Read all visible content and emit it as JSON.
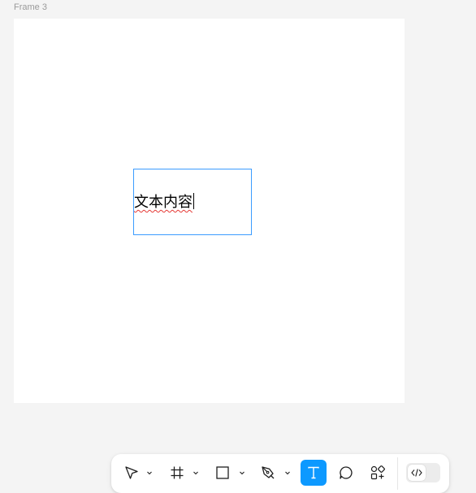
{
  "canvas": {
    "frame_label": "Frame 3",
    "text_layer": {
      "content": "文本内容",
      "selection_color": "#3b9cff",
      "spellcheck_color": "#e53935"
    }
  },
  "toolbar": {
    "tools": [
      {
        "name": "move-tool",
        "icon": "pointer-arrow-icon",
        "has_dropdown": true,
        "active": false
      },
      {
        "name": "frame-tool",
        "icon": "hash-frame-icon",
        "has_dropdown": true,
        "active": false
      },
      {
        "name": "shape-tool",
        "icon": "rectangle-icon",
        "has_dropdown": true,
        "active": false
      },
      {
        "name": "pen-tool",
        "icon": "pen-icon",
        "has_dropdown": true,
        "active": false
      },
      {
        "name": "text-tool",
        "icon": "text-t-icon",
        "has_dropdown": false,
        "active": true
      },
      {
        "name": "comment-tool",
        "icon": "speech-bubble-icon",
        "has_dropdown": false,
        "active": false
      },
      {
        "name": "actions-tool",
        "icon": "shapes-plus-icon",
        "has_dropdown": false,
        "active": false
      }
    ],
    "dev_mode": {
      "icon": "code-brackets-icon",
      "enabled": false
    },
    "accent_color": "#0d99ff"
  }
}
